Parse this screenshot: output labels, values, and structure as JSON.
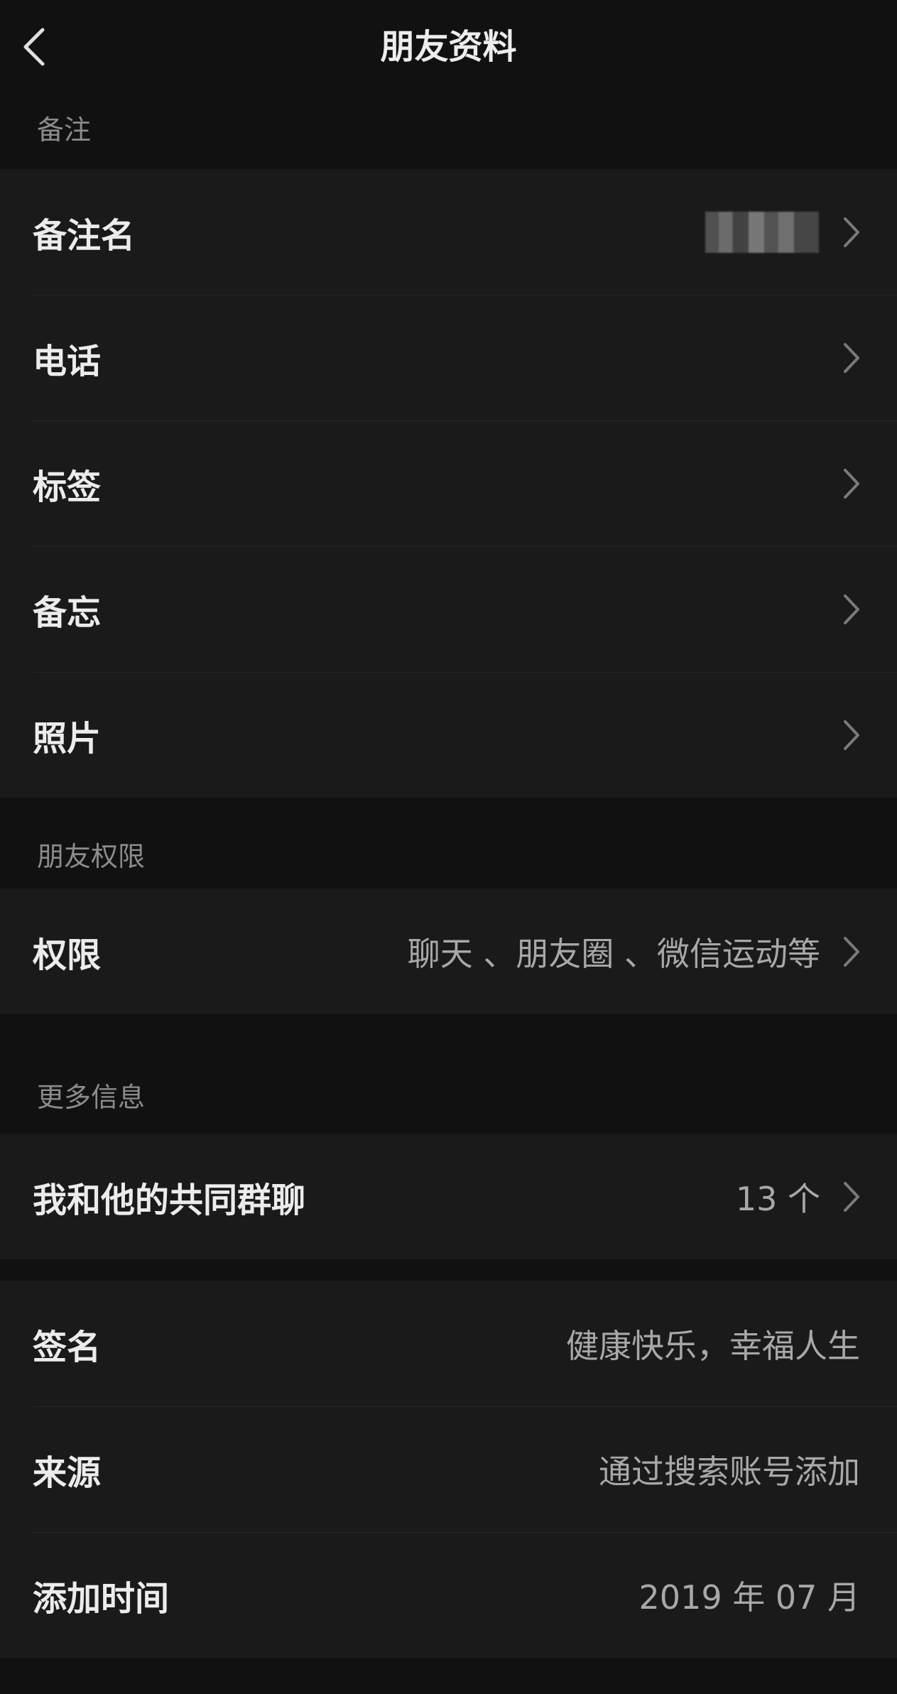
{
  "header": {
    "title": "朋友资料"
  },
  "sections": {
    "remark": {
      "label": "备注",
      "rows": [
        {
          "label": "备注名"
        },
        {
          "label": "电话"
        },
        {
          "label": "标签"
        },
        {
          "label": "备忘"
        },
        {
          "label": "照片"
        }
      ]
    },
    "permissions": {
      "label": "朋友权限",
      "row": {
        "label": "权限",
        "value": "聊天 、朋友圈 、微信运动等"
      }
    },
    "more": {
      "label": "更多信息",
      "common_groups": {
        "label": "我和他的共同群聊",
        "value": "13 个"
      },
      "info_rows": [
        {
          "label": "签名",
          "value": "健康快乐，幸福人生"
        },
        {
          "label": "来源",
          "value": "通过搜索账号添加"
        },
        {
          "label": "添加时间",
          "value": "2019 年 07 月"
        }
      ]
    }
  },
  "icons": {
    "back": "chevron-left-icon",
    "row_arrow": "chevron-right-icon"
  },
  "colors": {
    "background": "#111111",
    "cell": "#1a1a1a",
    "primary_text": "#ececec",
    "secondary_text": "#a8a8a8",
    "section_text": "#8c8c8c"
  }
}
